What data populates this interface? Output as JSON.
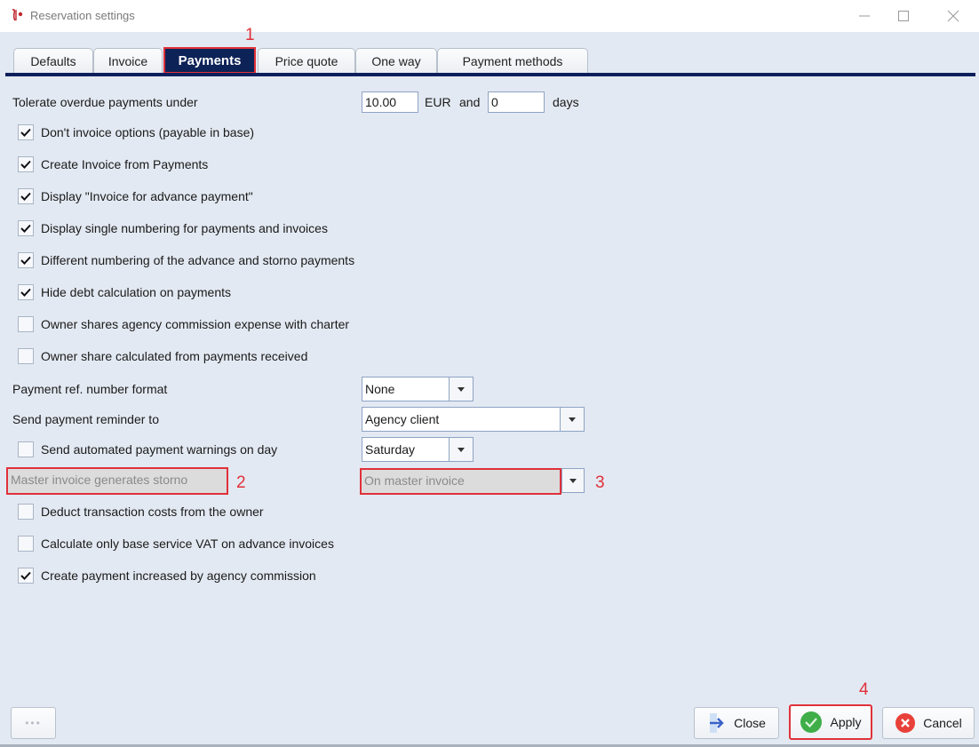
{
  "window": {
    "title": "Reservation settings",
    "controls": {
      "minimize": "minimize",
      "maximize": "maximize",
      "close": "close"
    }
  },
  "tabs": [
    {
      "label": "Defaults",
      "active": false
    },
    {
      "label": "Invoice",
      "active": false
    },
    {
      "label": "Payments",
      "active": true
    },
    {
      "label": "Price quote",
      "active": false
    },
    {
      "label": "One way",
      "active": false
    },
    {
      "label": "Payment methods",
      "active": false
    }
  ],
  "tolerance": {
    "label": "Tolerate overdue payments under",
    "amount": "10.00",
    "currency": "EUR",
    "and_label": "and",
    "days_value": "0",
    "days_label": "days"
  },
  "checkboxes_top": [
    {
      "label": "Don't invoice options (payable in base)",
      "checked": true
    },
    {
      "label": "Create Invoice from Payments",
      "checked": true
    },
    {
      "label": "Display \"Invoice for advance payment\"",
      "checked": true
    },
    {
      "label": "Display single numbering for payments and invoices",
      "checked": true
    },
    {
      "label": "Different numbering of the advance and storno payments",
      "checked": true
    },
    {
      "label": "Hide debt calculation on payments",
      "checked": true
    },
    {
      "label": "Owner shares agency commission expense with charter",
      "checked": false
    },
    {
      "label": "Owner share calculated from payments received",
      "checked": false
    }
  ],
  "ref_format": {
    "label": "Payment ref. number format",
    "value": "None"
  },
  "reminder": {
    "label": "Send payment reminder to",
    "value": "Agency client"
  },
  "warnings": {
    "label": "Send automated payment warnings on day",
    "checked": false,
    "value": "Saturday"
  },
  "master_storno": {
    "label": "Master invoice generates storno",
    "value": "On master invoice",
    "disabled": true
  },
  "checkboxes_bottom": [
    {
      "label": "Deduct transaction costs from the owner",
      "checked": false
    },
    {
      "label": "Calculate only base service VAT on advance invoices",
      "checked": false
    },
    {
      "label": "Create payment increased by agency commission",
      "checked": true
    }
  ],
  "annotations": {
    "a1": "1",
    "a2": "2",
    "a3": "3",
    "a4": "4"
  },
  "footer": {
    "more_label": "•••",
    "close_label": "Close",
    "apply_label": "Apply",
    "cancel_label": "Cancel"
  },
  "colors": {
    "accent_navy": "#0c1f5c",
    "annotation_red": "#e0313a",
    "apply_green": "#3fae49",
    "cancel_red": "#e8413a",
    "close_arrow_blue": "#3a63c8"
  }
}
